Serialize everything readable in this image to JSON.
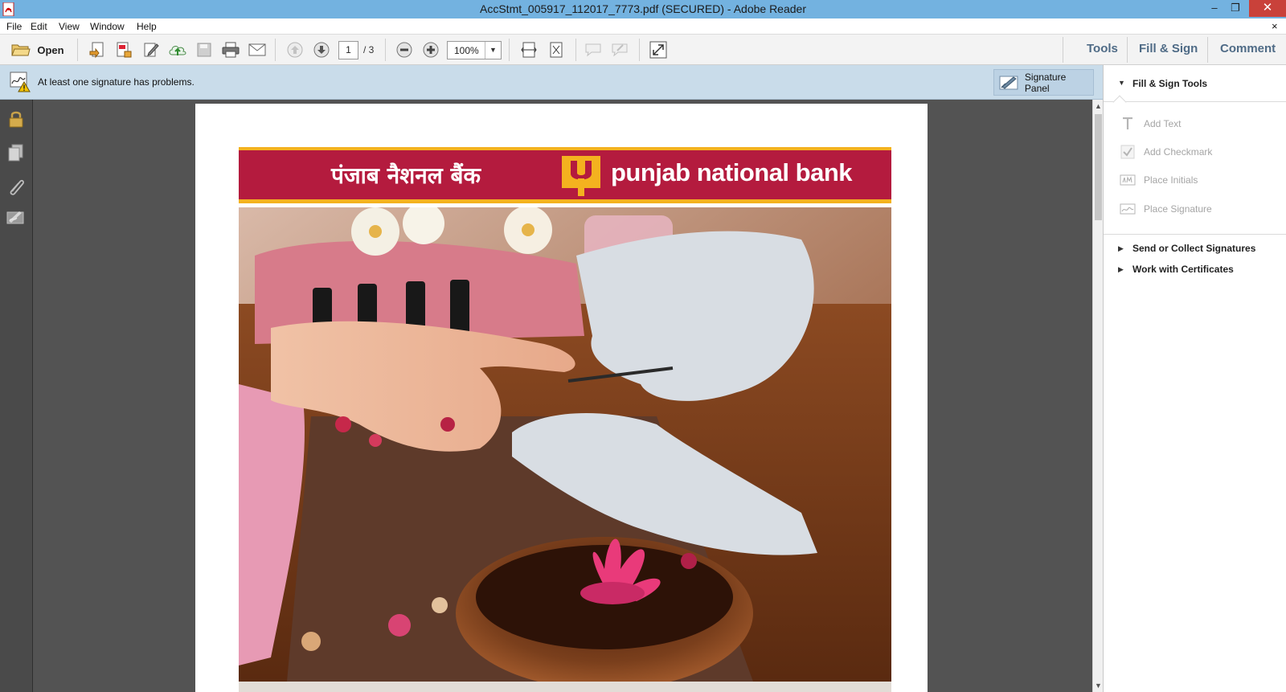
{
  "window": {
    "title": "AccStmt_005917_112017_7773.pdf (SECURED) - Adobe Reader",
    "minimize": "–",
    "maximize": "❐",
    "close": "✕"
  },
  "menu": {
    "items": [
      "File",
      "Edit",
      "View",
      "Window",
      "Help"
    ],
    "close": "×"
  },
  "toolbar": {
    "open_label": "Open",
    "page_current": "1",
    "page_total": "/ 3",
    "zoom": "100%",
    "right_tabs": [
      "Tools",
      "Fill & Sign",
      "Comment"
    ]
  },
  "signature_bar": {
    "message": "At least one signature has problems.",
    "panel_button": "Signature Panel"
  },
  "document": {
    "banner_hindi": "पंजाब नैशनल बैंक",
    "banner_english": "punjab national bank",
    "banner_color": "#b41b3e",
    "accent_color": "#f4b21f"
  },
  "right_pane": {
    "header": "Fill & Sign Tools",
    "tools": [
      {
        "label": "Add Text",
        "icon": "text-t-icon"
      },
      {
        "label": "Add Checkmark",
        "icon": "checkmark-icon"
      },
      {
        "label": "Place Initials",
        "icon": "initials-icon"
      },
      {
        "label": "Place Signature",
        "icon": "signature-icon"
      }
    ],
    "sections": [
      "Send or Collect Signatures",
      "Work with Certificates"
    ]
  }
}
